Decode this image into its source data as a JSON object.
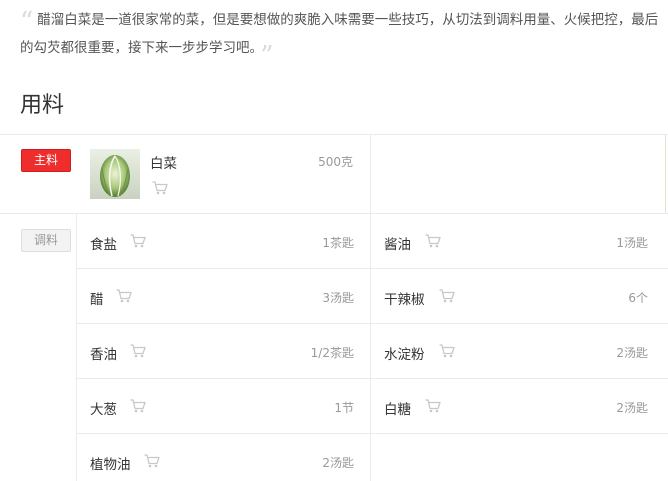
{
  "intro": {
    "text": "醋溜白菜是一道很家常的菜，但是要想做的爽脆入味需要一些技巧，从切法到调料用量、火候把控，最后的勾芡都很重要，接下来一步步学习吧。",
    "quote_open": "“",
    "quote_close": "”"
  },
  "section_title": "用料",
  "main": {
    "badge": "主料",
    "items": [
      {
        "name": "白菜",
        "qty": "500克",
        "icon": "cart-icon"
      }
    ]
  },
  "seasoning": {
    "badge": "调料",
    "items": [
      {
        "name": "食盐",
        "qty": "1茶匙",
        "icon": "cart-icon"
      },
      {
        "name": "酱油",
        "qty": "1汤匙",
        "icon": "cart-icon"
      },
      {
        "name": "醋",
        "qty": "3汤匙",
        "icon": "cart-icon"
      },
      {
        "name": "干辣椒",
        "qty": "6个",
        "icon": "cart-icon"
      },
      {
        "name": "香油",
        "qty": "1/2茶匙",
        "icon": "cart-icon"
      },
      {
        "name": "水淀粉",
        "qty": "2汤匙",
        "icon": "cart-icon"
      },
      {
        "name": "大葱",
        "qty": "1节",
        "icon": "cart-icon"
      },
      {
        "name": "白糖",
        "qty": "2汤匙",
        "icon": "cart-icon"
      },
      {
        "name": "植物油",
        "qty": "2汤匙",
        "icon": "cart-icon"
      }
    ]
  },
  "colors": {
    "main_badge": "#ee2d2d",
    "cart_icon": "#c8c8c8",
    "divider": "#ebebeb"
  }
}
